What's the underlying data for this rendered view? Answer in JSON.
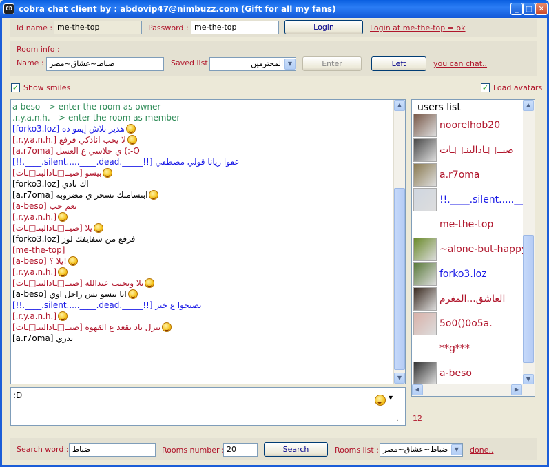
{
  "window": {
    "app_icon": "CD",
    "title": "cobra chat client by : abdovip47@nimbuzz.com (Gift for all my fans)"
  },
  "login": {
    "id_label": "Id name :",
    "id_value": "me-the-top",
    "password_label": "Password :",
    "password_value": "me-the-top",
    "login_button": "Login",
    "status_link": "Login at  me-the-top = ok"
  },
  "room": {
    "section_label": "Room info :",
    "name_label": "Name :",
    "name_value": "ضباط~عشاق~مصر",
    "saved_label": "Saved list :",
    "saved_value": "المحترمين",
    "enter_button": "Enter",
    "left_button": "Left",
    "chat_link": "you can chat.."
  },
  "options": {
    "show_smiles": "Show smiles",
    "load_avatars": "Load avatars"
  },
  "chat": {
    "lines": [
      {
        "text": "a-beso  -->  enter the room as owner",
        "color": "#2e8b57",
        "smile": false,
        "rtl": false
      },
      {
        "text": ".r.y.a.n.h.  -->  enter the room as member",
        "color": "#2e8b57",
        "smile": false,
        "rtl": false
      },
      {
        "text": "[forko3.loz] هدير بلاش إيمو ده",
        "color": "#1a1ae6",
        "smile": true,
        "rtl": false
      },
      {
        "text": "[.r.y.a.n.h.] لا يحب انادكي فرفع",
        "color": "#b0152b",
        "smile": true,
        "rtl": false
      },
      {
        "text": "[a.r7oma] ي خلاسي ع العسل (:-O",
        "color": "#b0152b",
        "smile": false,
        "rtl": false
      },
      {
        "text": "[!!.____.silent.....____.dead._____!!] عفوا ريانا قولي مصطفي",
        "color": "#1a1ae6",
        "smile": false,
        "rtl": false
      },
      {
        "text": "[صيــ□ـادالبنـ□ـات] بيسو",
        "color": "#b0152b",
        "smile": true,
        "rtl": false
      },
      {
        "text": "[forko3.loz] اك نادي",
        "color": "#000000",
        "smile": false,
        "rtl": false
      },
      {
        "text": "[a.r7oma] ابتسامتك تسحر ي مضروبه",
        "color": "#000000",
        "smile": true,
        "rtl": false
      },
      {
        "text": "[a-beso] نعم حب",
        "color": "#b0152b",
        "smile": false,
        "rtl": false
      },
      {
        "text": "[.r.y.a.n.h.]",
        "color": "#b0152b",
        "smile": true,
        "rtl": false
      },
      {
        "text": "[صيــ□ـادالبنـ□ـات] يلا",
        "color": "#b0152b",
        "smile": true,
        "rtl": false
      },
      {
        "text": "[forko3.loz] فرفع من شفايفك لوز",
        "color": "#000000",
        "smile": false,
        "rtl": false
      },
      {
        "text": "[me-the-top]",
        "color": "#b0152b",
        "smile": false,
        "rtl": false
      },
      {
        "text": "[a-beso] يلا ؟!",
        "color": "#b0152b",
        "smile": true,
        "rtl": false
      },
      {
        "text": "[.r.y.a.n.h.]",
        "color": "#b0152b",
        "smile": true,
        "rtl": false
      },
      {
        "text": "[صيــ□ـادالبنـ□ـات] يلا ونجيب عبدالله",
        "color": "#b0152b",
        "smile": true,
        "rtl": false
      },
      {
        "text": "[a-beso] انا بيسو بس راجل اوي",
        "color": "#000000",
        "smile": true,
        "rtl": false
      },
      {
        "text": "[!!.____.silent.....____.dead._____!!] تصبحوا ع خير",
        "color": "#1a1ae6",
        "smile": false,
        "rtl": false
      },
      {
        "text": "[.r.y.a.n.h.]",
        "color": "#b0152b",
        "smile": true,
        "rtl": false
      },
      {
        "text": "[صيــ□ـادالبنـ□ـات] تنزل ياد نقعد ع القهوه",
        "color": "#b0152b",
        "smile": true,
        "rtl": false
      },
      {
        "text": "[a.r7oma] بدري",
        "color": "#000000",
        "smile": false,
        "rtl": false
      }
    ],
    "input_value": ":D"
  },
  "users": {
    "header": "users list",
    "count": "12",
    "items": [
      {
        "name": "noorelhob20",
        "color": "#b0152b",
        "avatar": "#7a5a4a"
      },
      {
        "name": "صيــ□ـادالبنـ□ـات",
        "color": "#b0152b",
        "avatar": "#4a4a4a"
      },
      {
        "name": "a.r7oma",
        "color": "#b0152b",
        "avatar": "#8a7a50"
      },
      {
        "name": "!!.____.silent.....____.d",
        "color": "#1a1ae6",
        "avatar": "#cfd6e0"
      },
      {
        "name": "me-the-top",
        "color": "#b0152b",
        "avatar": ""
      },
      {
        "name": "~alone-but-happy~",
        "color": "#b0152b",
        "avatar": "#6a8a2a"
      },
      {
        "name": "forko3.loz",
        "color": "#1a1ae6",
        "avatar": "#5a7a3a"
      },
      {
        "name": "العاشق...المغرم",
        "color": "#b0152b",
        "avatar": "#3a2a20"
      },
      {
        "name": "5o0()0o5a.",
        "color": "#b0152b",
        "avatar": "#d8b0a8"
      },
      {
        "name": "**g***",
        "color": "#b0152b",
        "avatar": ""
      },
      {
        "name": "a-beso",
        "color": "#b0152b",
        "avatar": "#333333"
      }
    ]
  },
  "search": {
    "word_label": "Search word :",
    "word_value": "ضباط",
    "rooms_number_label": "Rooms number :",
    "rooms_number_value": "20",
    "search_button": "Search",
    "rooms_list_label": "Rooms list :",
    "rooms_list_value": "ضباط~عشاق~مصر",
    "done_link": "done.."
  },
  "colors": {
    "accent_red": "#b0152b",
    "title_blue": "#0a5fe0",
    "check_green": "#21a121"
  }
}
